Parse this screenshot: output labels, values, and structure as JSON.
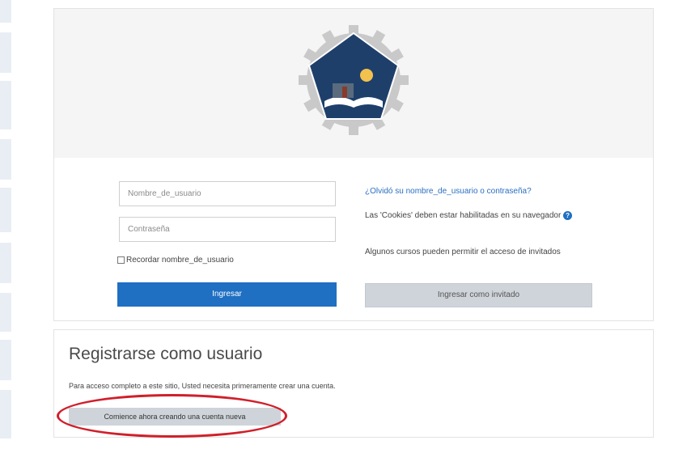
{
  "login": {
    "username_placeholder": "Nombre_de_usuario",
    "password_placeholder": "Contraseña",
    "remember_label": "Recordar nombre_de_usuario",
    "login_button": "Ingresar",
    "forgot_link": "¿Olvidó su nombre_de_usuario o contraseña?",
    "cookies_notice": "Las 'Cookies' deben estar habilitadas en su navegador",
    "guest_notice": "Algunos cursos pueden permitir el acceso de invitados",
    "guest_button": "Ingresar como invitado"
  },
  "signup": {
    "title": "Registrarse como usuario",
    "description": "Para acceso completo a este sitio, Usted necesita primeramente crear una cuenta.",
    "create_button": "Comience ahora creando una cuenta nueva"
  },
  "colors": {
    "primary": "#1f6fc2",
    "secondary_button": "#ced4da",
    "highlight": "#d01f2a",
    "logo_navy": "#1f3f6b"
  },
  "icons": [
    "institution-logo",
    "help-icon"
  ]
}
